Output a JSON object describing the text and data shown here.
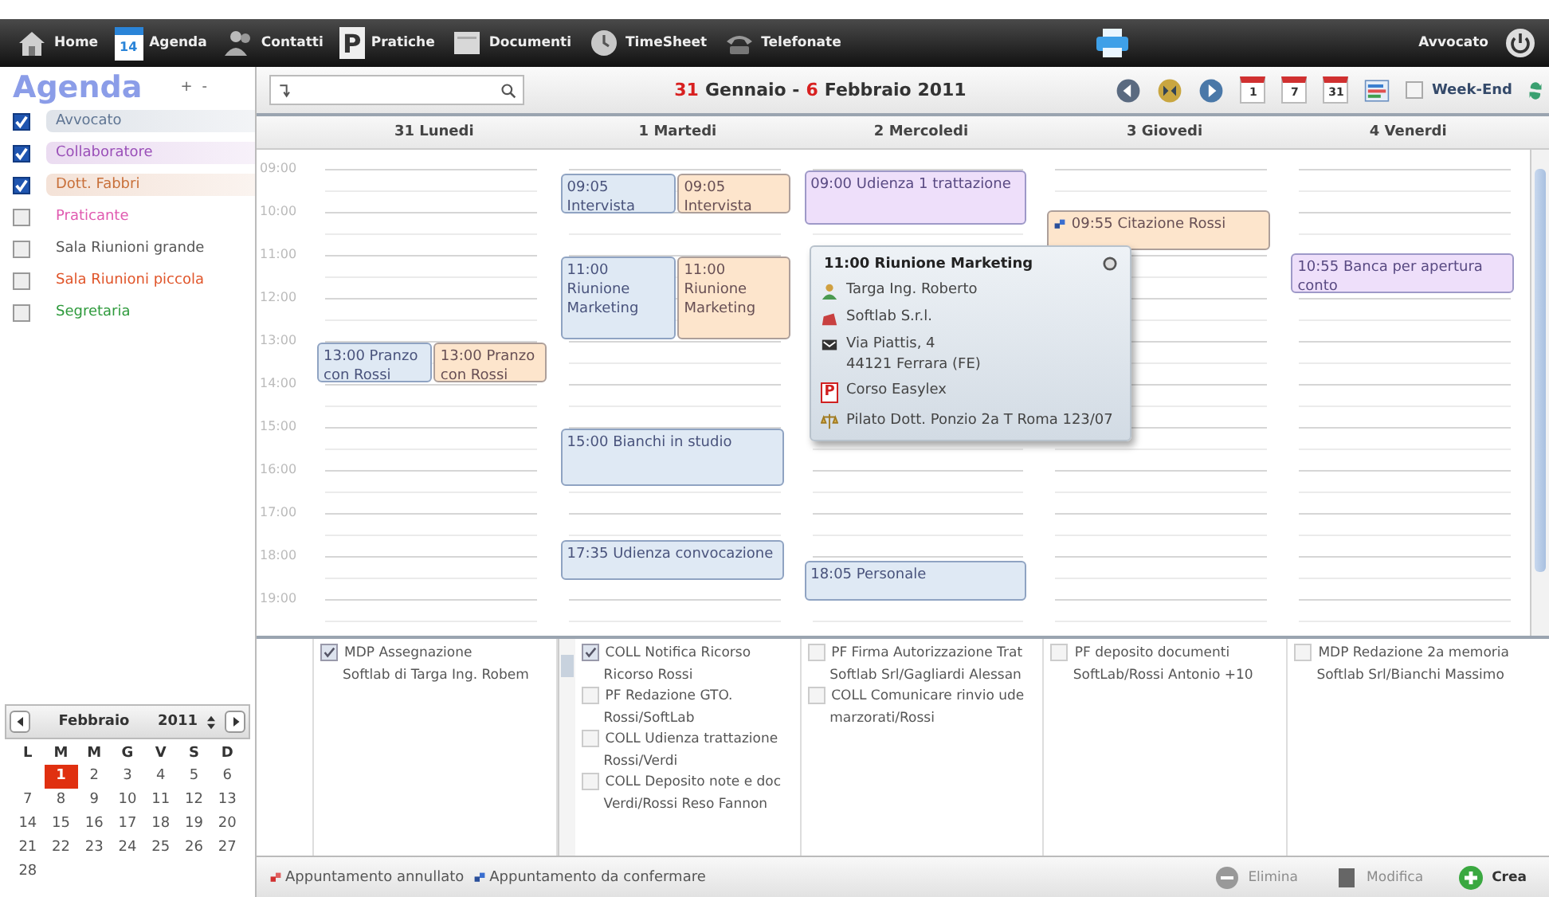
{
  "nav": {
    "items": [
      {
        "label": "Home"
      },
      {
        "label": "Agenda",
        "badge": "14"
      },
      {
        "label": "Contatti"
      },
      {
        "label": "Pratiche",
        "badge": "P"
      },
      {
        "label": "Documenti"
      },
      {
        "label": "TimeSheet"
      },
      {
        "label": "Telefonate"
      }
    ],
    "user": "Avvocato"
  },
  "sidebar": {
    "title": "Agenda",
    "add": "+",
    "remove": "-",
    "calendars": [
      {
        "label": "Avvocato",
        "checked": true,
        "color": "#5f7593"
      },
      {
        "label": "Collaboratore",
        "checked": true,
        "color": "#9a4fb8"
      },
      {
        "label": "Dott. Fabbri",
        "checked": true,
        "color": "#c8703a"
      },
      {
        "label": "Praticante",
        "checked": false,
        "color": "#e05ab0"
      },
      {
        "label": "Sala Riunioni grande",
        "checked": false,
        "color": "#555555"
      },
      {
        "label": "Sala Riunioni piccola",
        "checked": false,
        "color": "#e0552a"
      },
      {
        "label": "Segretaria",
        "checked": false,
        "color": "#2e9a3c"
      }
    ]
  },
  "mini_calendar": {
    "month": "Febbraio",
    "year": "2011",
    "weekdays": [
      "L",
      "M",
      "M",
      "G",
      "V",
      "S",
      "D"
    ],
    "weeks": [
      [
        {
          "day": "1",
          "selected": true
        },
        {
          "day": "2",
          "selected": false
        },
        {
          "day": "3",
          "selected": false
        },
        {
          "day": "4",
          "selected": false
        },
        {
          "day": "5",
          "selected": false
        },
        {
          "day": "6",
          "selected": false
        }
      ],
      [
        {
          "day": "7",
          "selected": false
        },
        {
          "day": "8",
          "selected": false
        },
        {
          "day": "9",
          "selected": false
        },
        {
          "day": "10",
          "selected": false
        },
        {
          "day": "11",
          "selected": false
        },
        {
          "day": "12",
          "selected": false
        },
        {
          "day": "13",
          "selected": false
        }
      ],
      [
        {
          "day": "14",
          "selected": false
        },
        {
          "day": "15",
          "selected": false
        },
        {
          "day": "16",
          "selected": false
        },
        {
          "day": "17",
          "selected": false
        },
        {
          "day": "18",
          "selected": false
        },
        {
          "day": "19",
          "selected": false
        },
        {
          "day": "20",
          "selected": false
        }
      ],
      [
        {
          "day": "21",
          "selected": false
        },
        {
          "day": "22",
          "selected": false
        },
        {
          "day": "23",
          "selected": false
        },
        {
          "day": "24",
          "selected": false
        },
        {
          "day": "25",
          "selected": false
        },
        {
          "day": "26",
          "selected": false
        },
        {
          "day": "27",
          "selected": false
        }
      ],
      [
        {
          "day": "28",
          "selected": false
        }
      ]
    ]
  },
  "toolbar": {
    "range": {
      "from_day": "31",
      "from_rest": "Gennaio -",
      "to_day": "6",
      "to_rest": "Febbraio 2011"
    },
    "views": [
      "1",
      "7",
      "31"
    ],
    "weekend": {
      "label": "Week-End",
      "checked": false
    }
  },
  "hours": [
    "09:00",
    "10:00",
    "11:00",
    "12:00",
    "13:00",
    "14:00",
    "15:00",
    "16:00",
    "17:00",
    "18:00",
    "19:00"
  ],
  "days": [
    {
      "label": "31 Lunedi",
      "events": [
        {
          "time": "13:00",
          "title": "Pranzo con Rossi",
          "kind": "left",
          "color": "#dfe9f4",
          "pending": false
        },
        {
          "time": "13:00",
          "title": "Pranzo con Rossi",
          "kind": "right",
          "color": "#fde5cc",
          "pending": false
        }
      ],
      "scrollable": false,
      "tasks": [
        {
          "title": "MDP Assegnazione",
          "subtitle": "Softlab di Targa Ing. Robem",
          "checked": true
        }
      ]
    },
    {
      "label": "1 Martedi",
      "events": [
        {
          "time": "09:05",
          "title": "Intervista",
          "kind": "left",
          "color": "#dfe9f4",
          "pending": false
        },
        {
          "time": "09:05",
          "title": "Intervista",
          "kind": "right",
          "color": "#fde5cc",
          "pending": false
        },
        {
          "time": "11:00",
          "title": "Riunione Marketing",
          "kind": "left",
          "color": "#dfe9f4",
          "pending": false
        },
        {
          "time": "11:00",
          "title": "Riunione Marketing",
          "kind": "right",
          "color": "#fde5cc",
          "pending": false
        },
        {
          "time": "15:00",
          "title": "Bianchi in studio",
          "kind": "full",
          "color": "#dfe9f4",
          "pending": false
        },
        {
          "time": "17:35",
          "title": "Udienza convocazione",
          "kind": "full",
          "color": "#dfe9f4",
          "pending": false
        }
      ],
      "scrollable": true,
      "tasks": [
        {
          "title": "COLL Notifica Ricorso",
          "subtitle": "Ricorso Rossi",
          "checked": true
        },
        {
          "title": "PF Redazione GTO.",
          "subtitle": "Rossi/SoftLab",
          "checked": false
        },
        {
          "title": "COLL Udienza trattazione",
          "subtitle": "Rossi/Verdi",
          "checked": false
        },
        {
          "title": "COLL Deposito note e doc",
          "subtitle": "Verdi/Rossi Reso Fannon",
          "checked": false
        }
      ]
    },
    {
      "label": "2 Mercoledi",
      "events": [
        {
          "time": "09:00",
          "title": "Udienza 1 trattazione",
          "kind": "full",
          "color": "#eedffa",
          "pending": false
        },
        {
          "time": "18:05",
          "title": "Personale",
          "kind": "full",
          "color": "#dfe9f4",
          "pending": false
        }
      ],
      "scrollable": false,
      "tasks": [
        {
          "title": "PF Firma Autorizzazione Trat",
          "subtitle": "Softlab Srl/Gagliardi Alessan",
          "checked": false
        },
        {
          "title": "COLL Comunicare rinvio ude",
          "subtitle": "marzorati/Rossi",
          "checked": false
        }
      ]
    },
    {
      "label": "3 Giovedi",
      "events": [
        {
          "time": "09:55",
          "title": "Citazione Rossi",
          "kind": "full",
          "color": "#fde5cc",
          "pending": true
        }
      ],
      "scrollable": false,
      "tasks": [
        {
          "title": "PF deposito documenti",
          "subtitle": "SoftLab/Rossi Antonio +10",
          "checked": false
        }
      ]
    },
    {
      "label": "4 Venerdi",
      "events": [
        {
          "time": "10:55",
          "title": "Banca per apertura conto",
          "kind": "full",
          "color": "#eedffa",
          "pending": false
        }
      ],
      "scrollable": false,
      "tasks": [
        {
          "title": "MDP Redazione 2a memoria",
          "subtitle": "Softlab Srl/Bianchi Massimo",
          "checked": false
        }
      ]
    }
  ],
  "popup": {
    "title": "11:00 Riunione Marketing",
    "rows": [
      {
        "lines": [
          "Targa Ing. Roberto"
        ]
      },
      {
        "lines": [
          "Softlab S.r.l."
        ]
      },
      {
        "lines": [
          "Via Piattis, 4",
          "44121 Ferrara (FE)"
        ]
      },
      {
        "badge": "P",
        "lines": [
          "Corso Easylex"
        ]
      },
      {
        "lines": [
          "Pilato Dott. Ponzio 2a T Roma 123/07"
        ]
      }
    ]
  },
  "footer": {
    "legend": [
      {
        "label": "Appuntamento annullato",
        "kind": "cancelled"
      },
      {
        "label": "Appuntamento da confermare",
        "kind": "pending"
      }
    ],
    "buttons": [
      {
        "label": "Elimina",
        "disabled": true
      },
      {
        "label": "Modifica",
        "disabled": true
      },
      {
        "label": "Crea",
        "disabled": false
      }
    ]
  }
}
